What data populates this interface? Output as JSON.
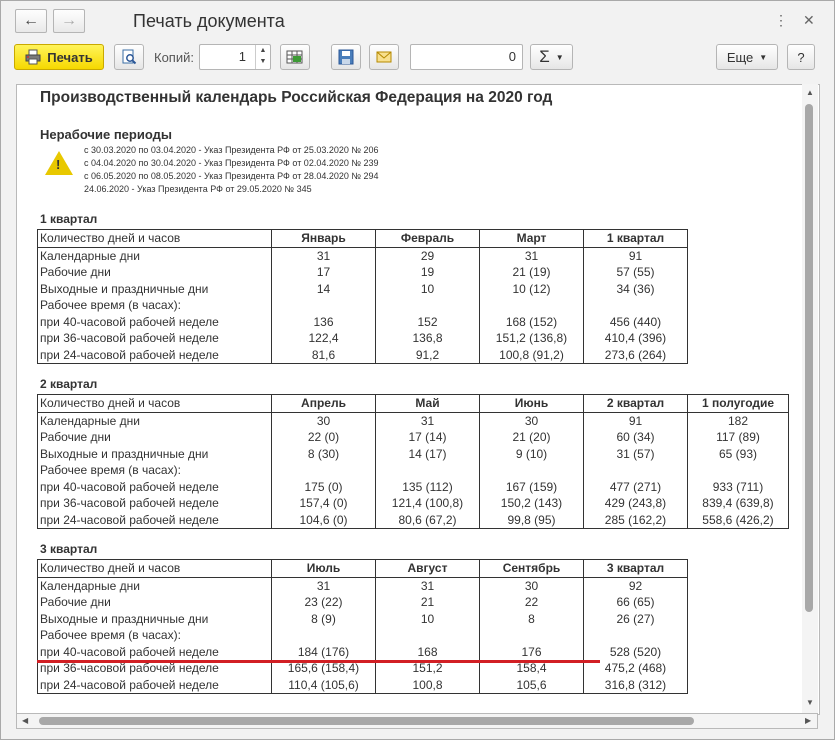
{
  "window": {
    "title": "Печать документа"
  },
  "toolbar": {
    "print_label": "Печать",
    "copies_label": "Копий:",
    "copies_value": "1",
    "sum_value": "0",
    "sum_symbol": "Σ",
    "more_label": "Еще",
    "help_label": "?"
  },
  "document": {
    "title": "Производственный календарь Российская Федерация на 2020 год",
    "nonwork_heading": "Нерабочие периоды",
    "nonwork_periods": [
      "с 30.03.2020 по 03.04.2020 - Указ Президента РФ от 25.03.2020 № 206",
      "с 04.04.2020 по 30.04.2020 - Указ Президента РФ от 02.04.2020 № 239",
      "с 06.05.2020 по 08.05.2020 - Указ Президента РФ от 28.04.2020 № 294",
      "24.06.2020 - Указ Президента РФ от 29.05.2020 № 345"
    ],
    "row_labels": {
      "header": "Количество дней и часов",
      "calendar": "Календарные дни",
      "work": "Рабочие дни",
      "weekend": "Выходные и праздничные дни",
      "hours": "Рабочее время (в часах):",
      "h40": "при 40-часовой рабочей неделе",
      "h36": "при 36-часовой рабочей неделе",
      "h24": "при 24-часовой рабочей неделе"
    },
    "quarters": [
      {
        "title": "1 квартал",
        "columns": [
          "Январь",
          "Февраль",
          "Март",
          "1 квартал"
        ],
        "calendar": [
          "31",
          "29",
          "31",
          "91"
        ],
        "work": [
          "17",
          "19",
          "21 (19)",
          "57 (55)"
        ],
        "weekend": [
          "14",
          "10",
          "10 (12)",
          "34 (36)"
        ],
        "h40": [
          "136",
          "152",
          "168 (152)",
          "456 (440)"
        ],
        "h36": [
          "122,4",
          "136,8",
          "151,2 (136,8)",
          "410,4 (396)"
        ],
        "h24": [
          "81,6",
          "91,2",
          "100,8 (91,2)",
          "273,6 (264)"
        ]
      },
      {
        "title": "2 квартал",
        "columns": [
          "Апрель",
          "Май",
          "Июнь",
          "2 квартал",
          "1 полугодие"
        ],
        "calendar": [
          "30",
          "31",
          "30",
          "91",
          "182"
        ],
        "work": [
          "22 (0)",
          "17 (14)",
          "21 (20)",
          "60 (34)",
          "117 (89)"
        ],
        "weekend": [
          "8 (30)",
          "14 (17)",
          "9 (10)",
          "31 (57)",
          "65 (93)"
        ],
        "h40": [
          "175 (0)",
          "135 (112)",
          "167 (159)",
          "477 (271)",
          "933 (711)"
        ],
        "h36": [
          "157,4 (0)",
          "121,4 (100,8)",
          "150,2 (143)",
          "429 (243,8)",
          "839,4 (639,8)"
        ],
        "h24": [
          "104,6 (0)",
          "80,6 (67,2)",
          "99,8 (95)",
          "285 (162,2)",
          "558,6 (426,2)"
        ]
      },
      {
        "title": "3 квартал",
        "columns": [
          "Июль",
          "Август",
          "Сентябрь",
          "3 квартал"
        ],
        "calendar": [
          "31",
          "31",
          "30",
          "92"
        ],
        "work": [
          "23 (22)",
          "21",
          "22",
          "66 (65)"
        ],
        "weekend": [
          "8 (9)",
          "10",
          "8",
          "26 (27)"
        ],
        "h40": [
          "184 (176)",
          "168",
          "176",
          "528 (520)"
        ],
        "h36": [
          "165,6 (158,4)",
          "151,2",
          "158,4",
          "475,2 (468)"
        ],
        "h24": [
          "110,4 (105,6)",
          "100,8",
          "105,6",
          "316,8 (312)"
        ]
      }
    ]
  },
  "colors": {
    "print_button": "#f6d800",
    "highlight_line": "#d21f24",
    "warning": "#e8c800"
  },
  "icons": [
    "back-arrow-icon",
    "forward-arrow-icon",
    "kebab-menu-icon",
    "close-icon",
    "printer-icon",
    "preview-icon",
    "table-settings-icon",
    "save-icon",
    "envelope-icon",
    "warning-icon"
  ]
}
